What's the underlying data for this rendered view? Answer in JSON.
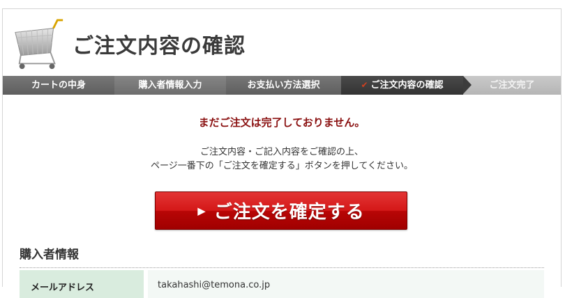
{
  "header": {
    "title": "ご注文内容の確認",
    "icon": "shopping-cart-icon"
  },
  "steps": [
    {
      "label": "カートの中身"
    },
    {
      "label": "購入者情報入力"
    },
    {
      "label": "お支払い方法選択"
    },
    {
      "label": "ご注文内容の確認",
      "check": "✔"
    },
    {
      "label": "ご注文完了"
    }
  ],
  "notice": "まだご注文は完了しておりません。",
  "instructions": {
    "line1": "ご注文内容・ご記入内容をご確認の上、",
    "line2": "ページ一番下の「ご注文を確定する」ボタンを押してください。"
  },
  "confirm_button": {
    "arrow": "▶",
    "label": "ご注文を確定する"
  },
  "buyer_section": {
    "title": "購入者情報",
    "rows": [
      {
        "label": "メールアドレス",
        "value": "takahashi@temona.co.jp"
      }
    ]
  },
  "colors": {
    "accent": "#8a1010",
    "button_red": "#d41818",
    "label_bg": "#d9ecde"
  }
}
